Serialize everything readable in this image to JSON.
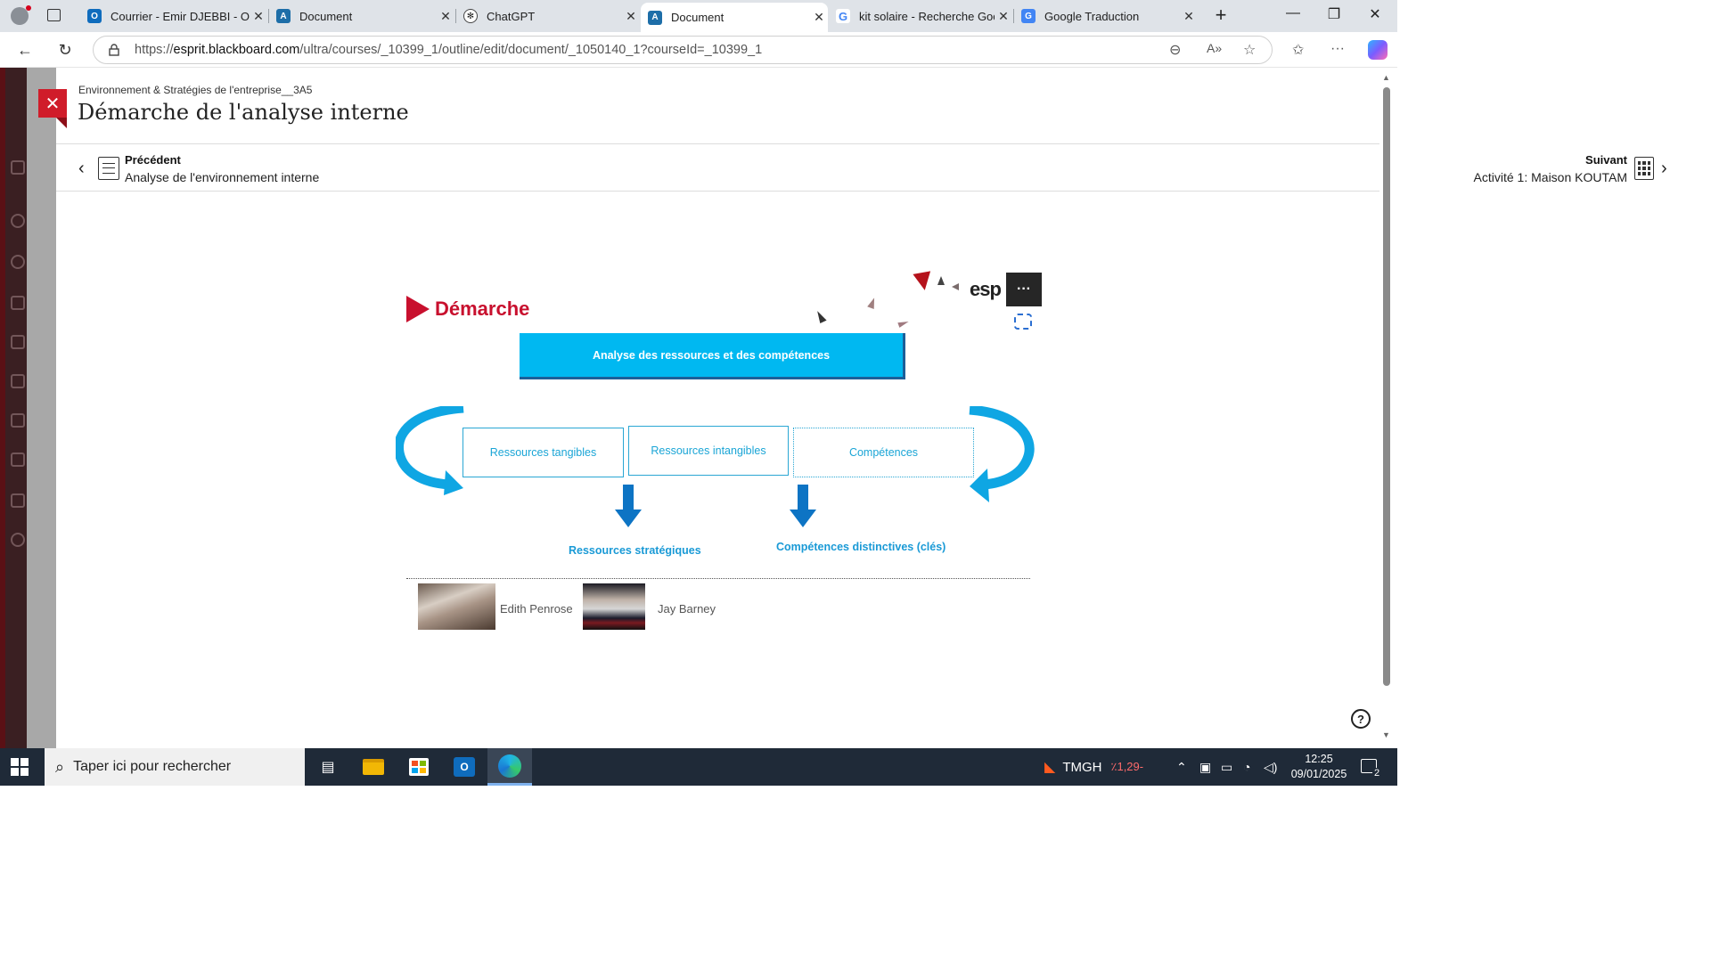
{
  "browser": {
    "tabs": [
      {
        "title": "Courrier - Emir DJEBBI - Outlook",
        "icon": "outlook-icon",
        "color": "#0f6cbd"
      },
      {
        "title": "Document",
        "icon": "blackboard-icon",
        "color": "#1d6ea8"
      },
      {
        "title": "ChatGPT",
        "icon": "chatgpt-icon",
        "color": "#222222"
      },
      {
        "title": "Document",
        "icon": "blackboard-icon",
        "color": "#1d6ea8",
        "active": true
      },
      {
        "title": "kit solaire - Recherche Google",
        "icon": "google-icon",
        "color": "#4285f4"
      },
      {
        "title": "Google Traduction",
        "icon": "google-translate-icon",
        "color": "#4285f4"
      }
    ],
    "url_prefix": "https://",
    "url_domain": "esprit.blackboard.com",
    "url_path": "/ultra/courses/_10399_1/outline/edit/document/_1050140_1?courseId=_10399_1"
  },
  "document": {
    "breadcrumb": "Environnement & Stratégies de l'entreprise__3A5",
    "title": "Démarche de l'analyse interne",
    "previous": {
      "label": "Précédent",
      "title": "Analyse de l'environnement interne"
    },
    "next": {
      "label": "Suivant",
      "title": "Activité 1: Maison KOUTAM"
    }
  },
  "slide": {
    "heading": "Démarche",
    "logo_text": "esp",
    "more_label": "···",
    "main_box": "Analyse des ressources et des compétences",
    "boxes": [
      "Ressources tangibles",
      "Ressources intangibles",
      "Compétences"
    ],
    "results": [
      "Ressources stratégiques",
      "Compétences distinctives (clés)"
    ],
    "people": [
      "Edith Penrose",
      "Jay Barney"
    ],
    "colors": {
      "accent_red": "#c8102e",
      "box_blue": "#00b8f1",
      "text_blue": "#1aa5d6",
      "arrow_blue": "#0d74c4"
    }
  },
  "taskbar": {
    "search_placeholder": "Taper ici pour rechercher",
    "ticker": "TMGH",
    "ticker_change": "٪1,29-",
    "time": "12:25",
    "date": "09/01/2025",
    "notifications": "2"
  }
}
